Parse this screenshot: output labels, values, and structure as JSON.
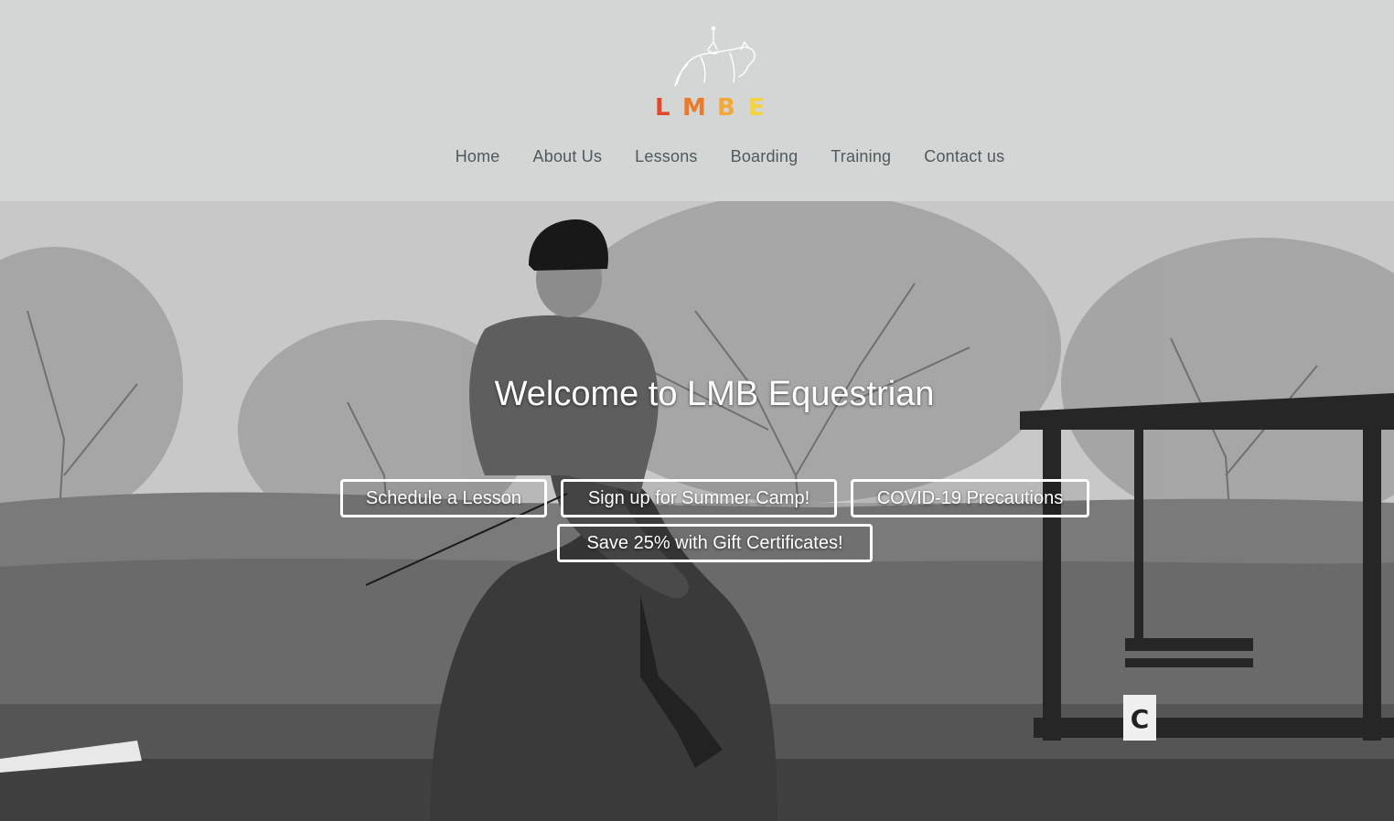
{
  "brand": {
    "logo_text": "LMBE",
    "logo_letters": [
      "L",
      "M",
      "B",
      "E"
    ],
    "logo_colors": [
      "#e2492b",
      "#ec7a2a",
      "#f2a93a",
      "#f4d33c"
    ]
  },
  "nav": {
    "items": [
      {
        "label": "Home"
      },
      {
        "label": "About Us"
      },
      {
        "label": "Lessons"
      },
      {
        "label": "Boarding"
      },
      {
        "label": "Training"
      },
      {
        "label": "Contact us"
      }
    ]
  },
  "hero": {
    "title": "Welcome to LMB Equestrian",
    "buttons": [
      {
        "label": "Schedule a Lesson"
      },
      {
        "label": "Sign up for Summer Camp!"
      },
      {
        "label": "COVID-19 Precautions"
      },
      {
        "label": "Save 25% with Gift Certificates!"
      }
    ],
    "arena_letter": "C"
  },
  "colors": {
    "header_bg": "#d3d6d4",
    "nav_text": "#4e5a5c",
    "button_border": "#ffffff"
  }
}
